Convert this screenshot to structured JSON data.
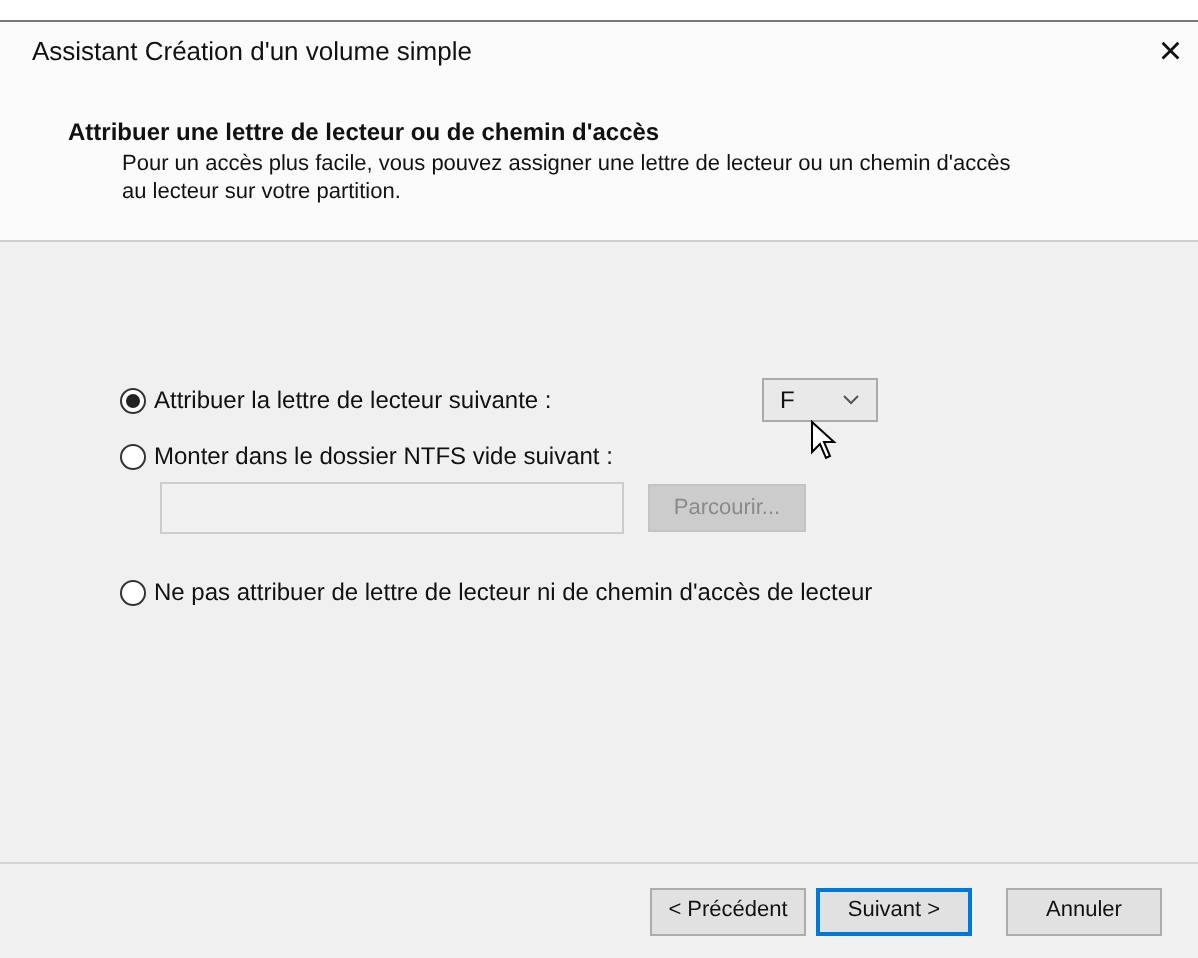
{
  "window": {
    "title": "Assistant Création d'un volume simple",
    "close": "×"
  },
  "header": {
    "title": "Attribuer une lettre de lecteur ou de chemin d'accès",
    "description": "Pour un accès plus facile, vous pouvez assigner une lettre de lecteur ou un chemin d'accès au lecteur sur votre partition."
  },
  "options": [
    {
      "label": "Attribuer la lettre de lecteur suivante :",
      "selected": true,
      "control": {
        "kind": "dropdown",
        "value": "F"
      }
    },
    {
      "label": "Monter dans le dossier NTFS vide suivant :",
      "selected": false,
      "control": {
        "kind": "folder",
        "disabled": true,
        "button": "Parcourir..."
      }
    },
    {
      "label": "Ne pas attribuer de lettre de lecteur ni de chemin d'accès de lecteur",
      "selected": false
    }
  ],
  "buttons": [
    {
      "label": "< Précédent",
      "default": false
    },
    {
      "label": "Suivant >",
      "default": true
    },
    {
      "label": "Annuler",
      "default": false
    }
  ]
}
